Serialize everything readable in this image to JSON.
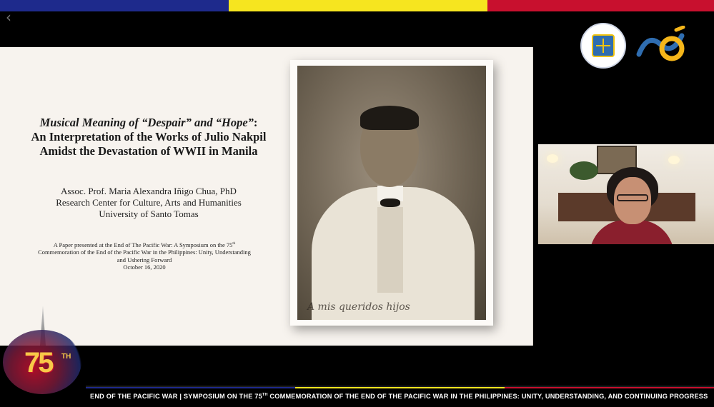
{
  "flag_colors": {
    "blue": "#1e2a8c",
    "yellow": "#f6e51f",
    "red": "#c8102e"
  },
  "nav": {
    "back_icon": "chevron-left-icon"
  },
  "logos": {
    "seal_icon": "university-seal-icon",
    "partner_icon": "anniversary-mark-icon"
  },
  "slide": {
    "title_italic": "Musical Meaning of “Despair” and “Hope”",
    "title_colon": ":",
    "title_line2": "An Interpretation of the Works of Julio Nakpil",
    "title_line3": "Amidst the Devastation of WWII in Manila",
    "author_name": "Assoc. Prof. Maria Alexandra Iñigo Chua, PhD",
    "author_affiliation": "Research Center for Culture, Arts and Humanities",
    "author_university": "University of Santo Tomas",
    "note_line1_before": "A Paper presented at the End of The Pacific War: A Symposium on the 75",
    "note_line1_sup": "th",
    "note_line2": "Commemoration of the End of the Pacific War in the Philippines: Unity, Understanding",
    "note_line3": "and Ushering Forward",
    "note_date": "October 16, 2020",
    "photo_signature": "A mis queridos hijos"
  },
  "video": {
    "speaker_icon": "speaker-video-feed"
  },
  "anniversary": {
    "number": "75",
    "suffix": "TH"
  },
  "ticker": {
    "text_before": "END OF THE PACIFIC WAR | SYMPOSIUM ON THE 75",
    "text_sup": "TH",
    "text_after": " COMMEMORATION OF THE END OF THE PACIFIC WAR IN THE PHILIPPINES: UNITY, UNDERSTANDING, AND CONTINUING PROGRESS"
  }
}
